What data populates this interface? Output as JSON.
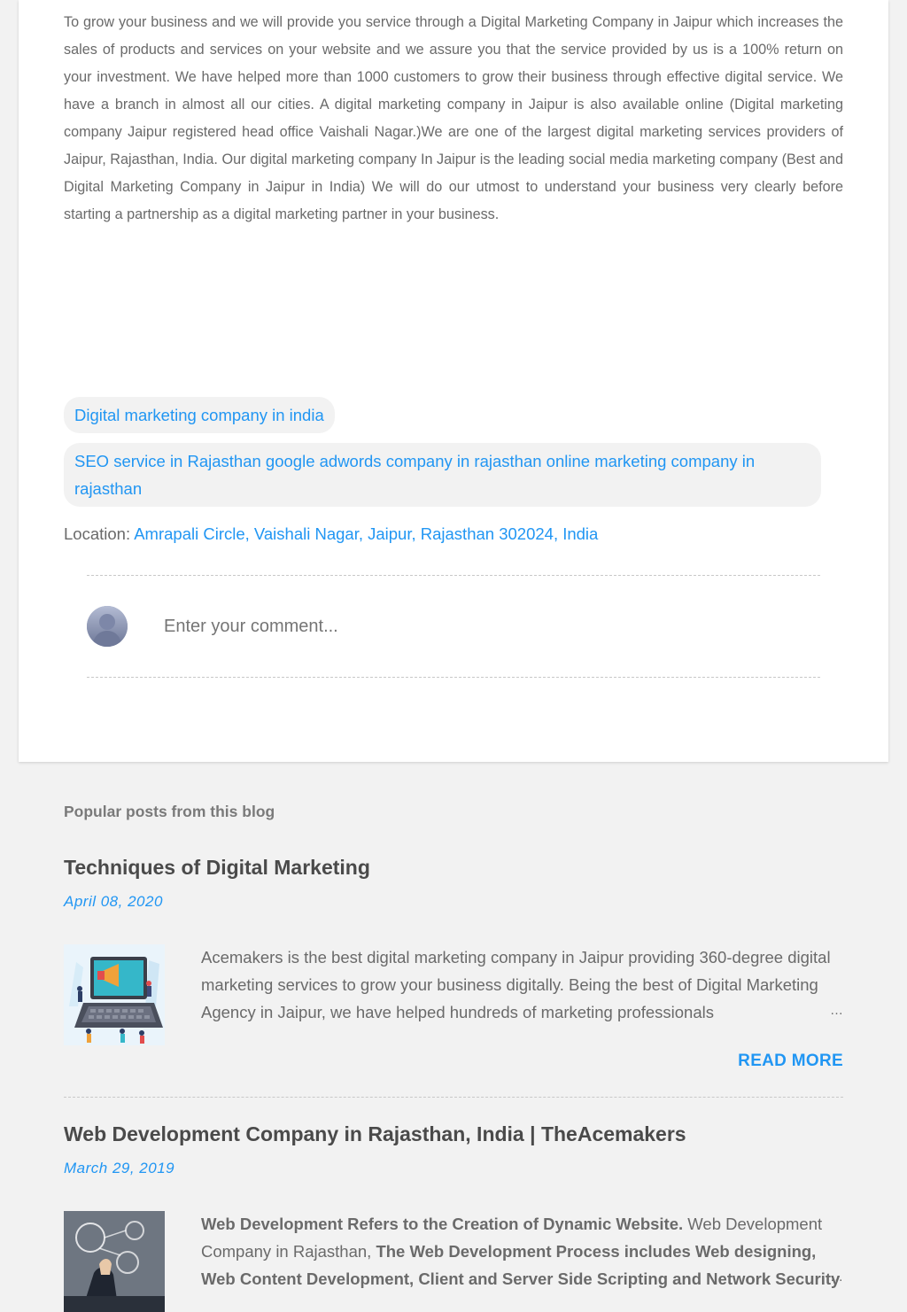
{
  "post": {
    "body": "To grow your business and we will provide you service through a Digital Marketing Company in Jaipur which increases the sales of products and services on your website and we assure you that the service provided by us is a 100% return on your investment. We have helped more than 1000 customers to grow their business through effective digital service. We have a branch in almost all our cities. A digital marketing company in Jaipur is also available online (Digital marketing company Jaipur registered head office Vaishali Nagar.)We are one of the largest digital marketing services providers of Jaipur, Rajasthan, India. Our digital marketing company In Jaipur is the leading social media marketing company (Best and Digital Marketing Company in Jaipur in India) We will do our utmost to understand your business very clearly before starting a partnership as a digital marketing partner in your business.",
    "labels": [
      "Digital marketing company in india",
      "SEO service in Rajasthan google adwords company in rajasthan online marketing company in rajasthan"
    ],
    "location_label": "Location:",
    "location_value": "Amrapali Circle, Vaishali Nagar, Jaipur, Rajasthan 302024, India"
  },
  "comment": {
    "placeholder": "Enter your comment..."
  },
  "popular": {
    "heading": "Popular posts from this blog",
    "posts": [
      {
        "title": "Techniques of Digital Marketing",
        "date": "April 08, 2020",
        "snippet": "Acemakers is the best digital marketing company in Jaipur providing 360-degree digital marketing services to grow your business digitally. Being the best of Digital Marketing Agency in Jaipur, we have helped hundreds of marketing professionals",
        "ellipsis": "…",
        "read_more": "READ MORE"
      },
      {
        "title": "Web Development Company in Rajasthan, India | TheAcemakers",
        "date": "March 29, 2019",
        "snippet_bold_1": "Web Development Refers to the Creation of Dynamic Website.",
        "snippet_plain_1": " Web Development Company in Rajasthan, ",
        "snippet_bold_2": "The Web Development Process includes Web designing, Web Content Development, Client and Server Side Scripting and Network Security",
        "ellipsis": "…"
      }
    ]
  },
  "colors": {
    "link": "#2196f3",
    "background": "#f2f2f2",
    "card": "#ffffff"
  }
}
